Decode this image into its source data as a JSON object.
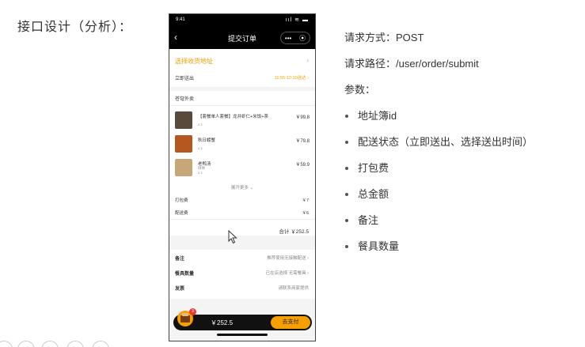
{
  "slide": {
    "title": "接口设计（分析）："
  },
  "phone": {
    "status_time": "9:41",
    "status_icons": "ııl ≋ ▬",
    "nav_title": "提交订单",
    "capsule_menu": "•••",
    "capsule_close": "⦿",
    "address": {
      "label": "选择收货地址",
      "chevron": "›"
    },
    "delivery": {
      "label": "立即送出",
      "time": "11:55-12:10送达 ›"
    },
    "order": {
      "header": "苍穹外卖",
      "items": [
        {
          "name": "【套餐单人套餐】龙井虾仁+米饭+茶",
          "sub": "",
          "qty": "x 1",
          "price": "￥99.8",
          "color": "#5a4a3a"
        },
        {
          "name": "秋日螃蟹",
          "sub": "",
          "qty": "x 1",
          "price": "￥79.8",
          "color": "#b5581f"
        },
        {
          "name": "老鸭汤",
          "sub": "微辣",
          "qty": "x 1",
          "price": "￥59.9",
          "color": "#c7a778"
        }
      ],
      "expand": "展开更多 ⌄",
      "pack_fee_label": "打包费",
      "pack_fee": "￥7",
      "delivery_fee_label": "配送费",
      "delivery_fee": "￥6",
      "total": "合计 ￥252.5"
    },
    "extras": [
      {
        "label": "备注",
        "value": "推荐使用无接触配送 ›"
      },
      {
        "label": "餐具数量",
        "value": "已在店选择  无需餐具 ›"
      },
      {
        "label": "发票",
        "value": "请联系商家提供"
      }
    ],
    "paybar": {
      "badge": "3",
      "total": "￥252.5",
      "button": "去支付"
    }
  },
  "info": {
    "method": "请求方式：POST",
    "path": "请求路径：/user/order/submit",
    "params_title": "参数：",
    "params": [
      "地址簿id",
      "配送状态（立即送出、选择送出时间）",
      "打包费",
      "总金额",
      "备注",
      "餐具数量"
    ]
  }
}
